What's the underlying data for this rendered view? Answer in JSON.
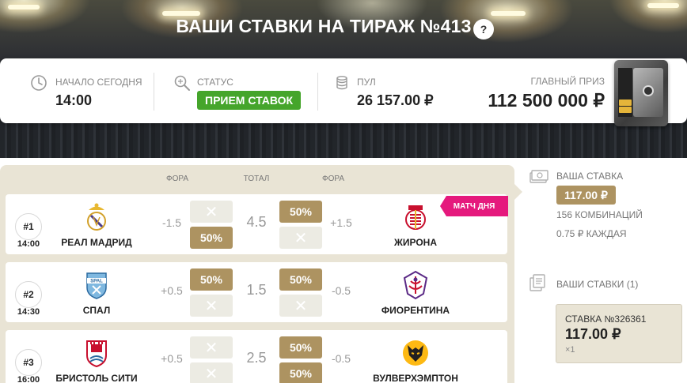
{
  "header": {
    "title": "ВАШИ СТАВКИ НА ТИРАЖ №413",
    "help_label": "?"
  },
  "info": {
    "start_label": "НАЧАЛО СЕГОДНЯ",
    "start_value": "14:00",
    "status_label": "СТАТУС",
    "status_value": "ПРИЕМ СТАВОК",
    "pool_label": "ПУЛ",
    "pool_value": "26 157.00 ₽",
    "prize_label": "ГЛАВНЫЙ ПРИЗ",
    "prize_value": "112 500 000 ₽"
  },
  "columns": {
    "handicap_left": "ФОРА",
    "total": "ТОТАЛ",
    "handicap_right": "ФОРА"
  },
  "match_of_day_label": "МАТЧ ДНЯ",
  "matches": [
    {
      "num": "#1",
      "time": "14:00",
      "home": "РЕАЛ МАДРИД",
      "away": "ЖИРОНА",
      "home_handicap": "-1.5",
      "total": "4.5",
      "away_handicap": "+1.5",
      "left_top": "✕",
      "left_bottom": "50%",
      "right_top": "50%",
      "right_bottom": "✕"
    },
    {
      "num": "#2",
      "time": "14:30",
      "home": "СПАЛ",
      "away": "ФИОРЕНТИНА",
      "home_handicap": "+0.5",
      "total": "1.5",
      "away_handicap": "-0.5",
      "left_top": "50%",
      "left_bottom": "✕",
      "right_top": "50%",
      "right_bottom": "✕"
    },
    {
      "num": "#3",
      "time": "16:00",
      "home": "БРИСТОЛЬ СИТИ",
      "away": "ВУЛВЕРХЭМПТОН",
      "home_handicap": "+0.5",
      "total": "2.5",
      "away_handicap": "-0.5",
      "left_top": "✕",
      "left_bottom": "✕",
      "right_top": "50%",
      "right_bottom": "50%"
    }
  ],
  "sidebar": {
    "your_bet_label": "ВАША СТАВКА",
    "your_bet_value": "117.00 ₽",
    "combinations": "156 КОМБИНАЦИЙ",
    "each": "0.75 ₽ КАЖДАЯ",
    "your_bets_title": "ВАШИ СТАВКИ (1)",
    "bet_card": {
      "title": "СТАВКА №326361",
      "amount": "117.00 ₽",
      "multiplier": "×1"
    }
  },
  "colors": {
    "accent_gold": "#ad9361",
    "status_green": "#45a52b",
    "match_of_day_pink": "#e5197d",
    "panel_beige": "#e9e4d5"
  }
}
